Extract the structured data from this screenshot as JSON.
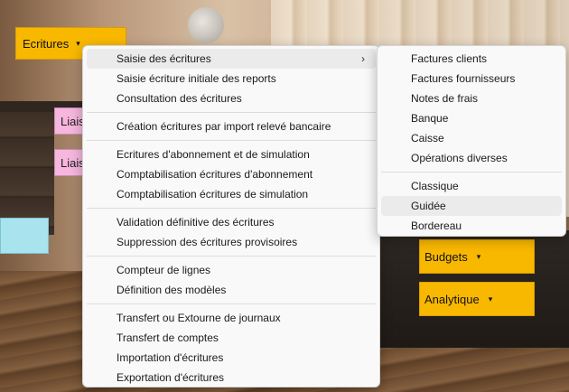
{
  "app_buttons": {
    "ecritures": "Ecritures",
    "liais1": "Liais",
    "liais2": "Liais",
    "budgets": "Budgets",
    "analytique": "Analytique"
  },
  "icons": {
    "caret": "▾",
    "submenu_arrow": "›"
  },
  "main_menu": {
    "group1": [
      "Saisie des écritures",
      "Saisie écriture initiale des reports",
      "Consultation des écritures"
    ],
    "group2": [
      "Création écritures par import relevé bancaire"
    ],
    "group3": [
      "Ecritures d'abonnement et de simulation",
      "Comptabilisation écritures d'abonnement",
      "Comptabilisation écritures de simulation"
    ],
    "group4": [
      "Validation définitive des écritures",
      "Suppression des écritures provisoires"
    ],
    "group5": [
      "Compteur de lignes",
      "Définition des modèles"
    ],
    "group6": [
      "Transfert ou Extourne de journaux",
      "Transfert de comptes",
      "Importation d'écritures",
      "Exportation d'écritures"
    ]
  },
  "sub_menu": {
    "group1": [
      "Factures clients",
      "Factures fournisseurs",
      "Notes de frais",
      "Banque",
      "Caisse",
      "Opérations diverses"
    ],
    "group2": [
      "Classique",
      "Guidée",
      "Bordereau"
    ]
  },
  "colors": {
    "accent": "#f9b800",
    "pink": "#f6b6dd",
    "cyan": "#a9e4ee",
    "menu_bg": "#f9f9f9",
    "highlight": "#ebebeb"
  }
}
